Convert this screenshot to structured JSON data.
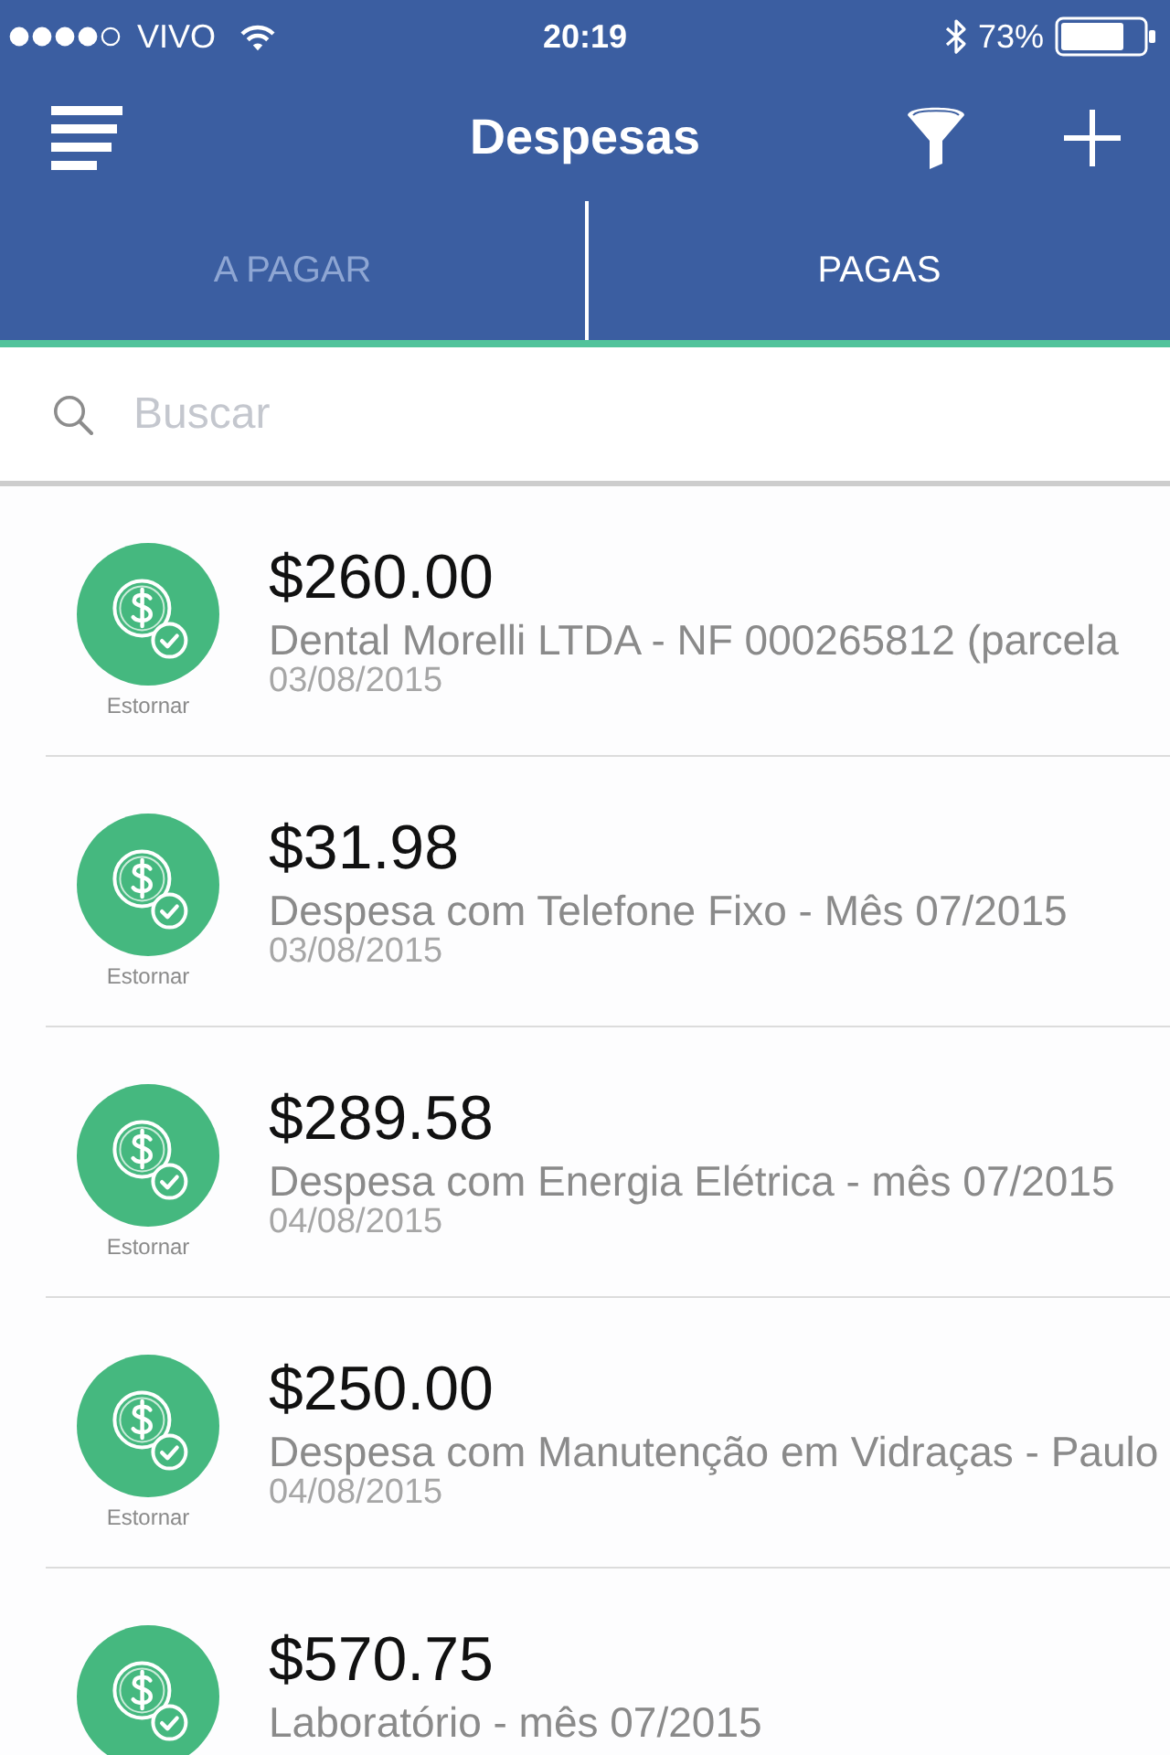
{
  "status_bar": {
    "carrier": "VIVO",
    "time": "20:19",
    "battery": "73%"
  },
  "nav_bar": {
    "title": "Despesas"
  },
  "tabs": [
    {
      "label": "A PAGAR",
      "selected": false
    },
    {
      "label": "PAGAS",
      "selected": true
    }
  ],
  "search": {
    "placeholder": "Buscar"
  },
  "expenses": [
    {
      "amount": "$260.00",
      "description": "Dental Morelli LTDA - NF 000265812 (parcela",
      "date": "03/08/2015",
      "action": "Estornar"
    },
    {
      "amount": "$31.98",
      "description": "Despesa com Telefone Fixo - Mês 07/2015",
      "date": "03/08/2015",
      "action": "Estornar"
    },
    {
      "amount": "$289.58",
      "description": "Despesa com Energia Elétrica - mês 07/2015",
      "date": "04/08/2015",
      "action": "Estornar"
    },
    {
      "amount": "$250.00",
      "description": "Despesa com Manutenção em Vidraças - Paulo",
      "date": "04/08/2015",
      "action": "Estornar"
    },
    {
      "amount": "$570.75",
      "description": "Laboratório - mês 07/2015"
    }
  ]
}
